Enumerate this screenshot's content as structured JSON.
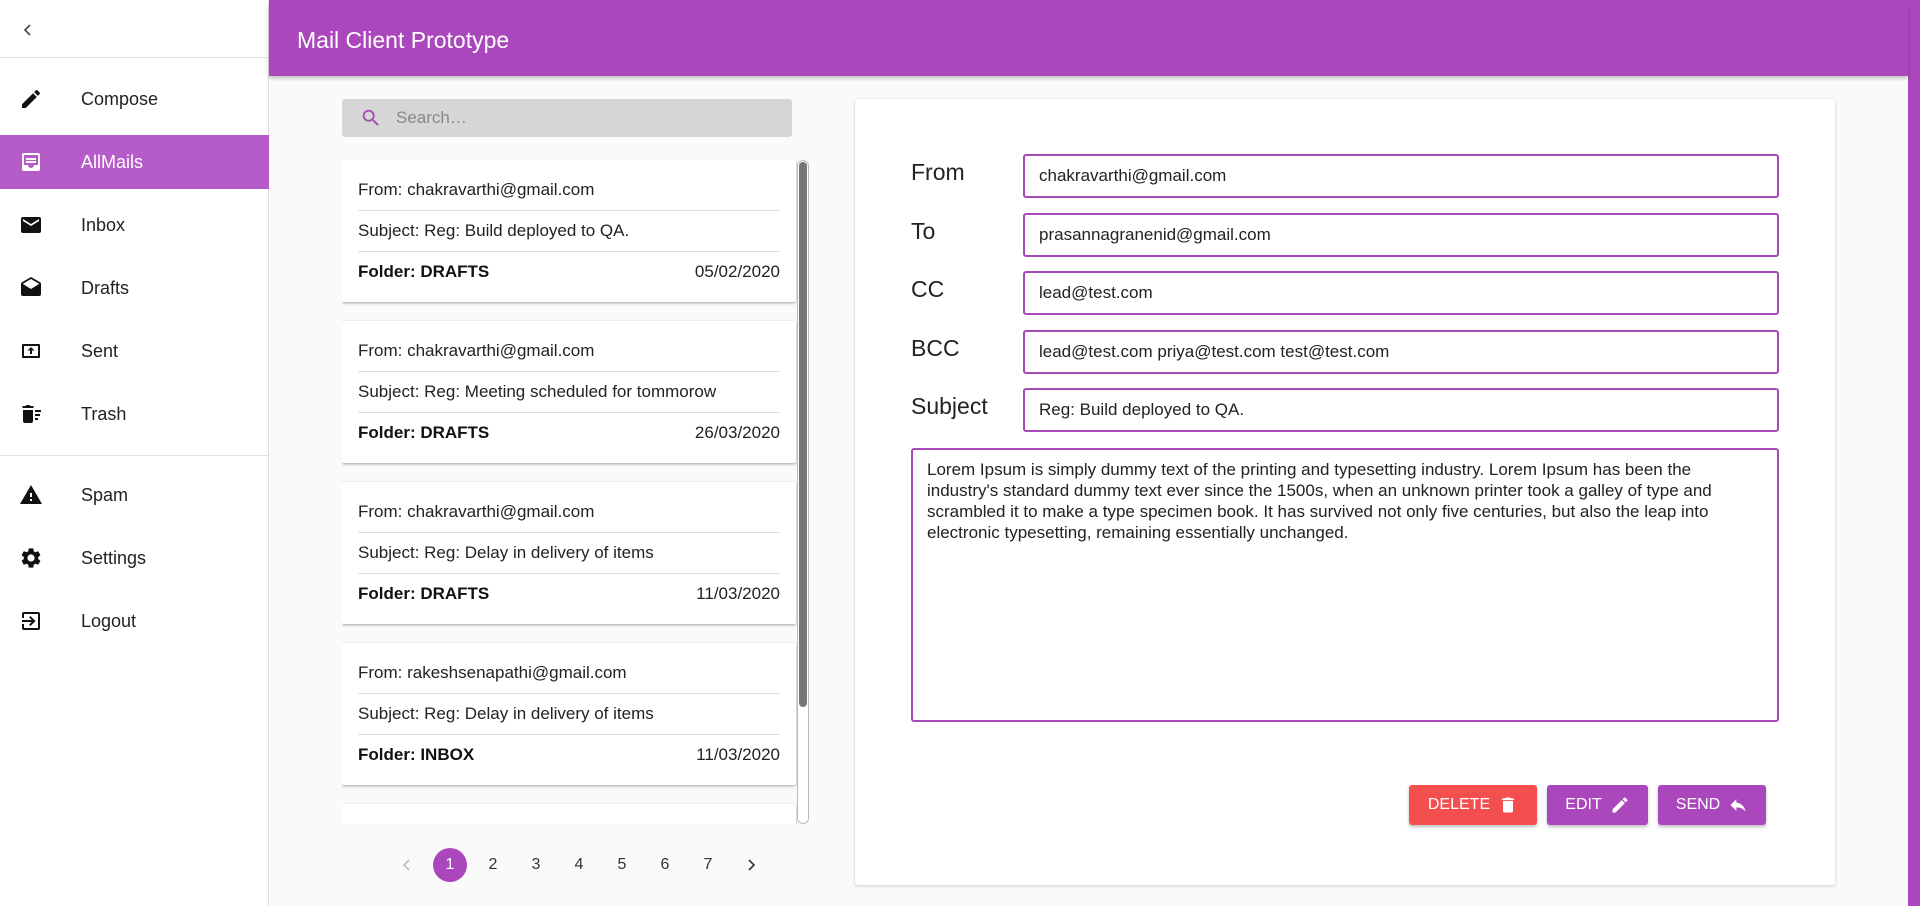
{
  "app": {
    "title": "Mail Client Prototype"
  },
  "colors": {
    "primary": "#ab47bc",
    "active_item": "#b55cc8",
    "danger": "#f44f4f"
  },
  "sidebar": {
    "collapse_icon": "chevron-left-icon",
    "items": [
      {
        "label": "Compose",
        "icon": "pencil-icon",
        "active": false
      },
      {
        "label": "AllMails",
        "icon": "inbox-tray-icon",
        "active": true
      },
      {
        "label": "Inbox",
        "icon": "envelope-icon",
        "active": false
      },
      {
        "label": "Drafts",
        "icon": "envelope-open-icon",
        "active": false
      },
      {
        "label": "Sent",
        "icon": "outbox-icon",
        "active": false
      },
      {
        "label": "Trash",
        "icon": "trash-icon",
        "active": false
      }
    ],
    "items2": [
      {
        "label": "Spam",
        "icon": "warning-icon"
      },
      {
        "label": "Settings",
        "icon": "gear-icon"
      },
      {
        "label": "Logout",
        "icon": "logout-icon"
      }
    ]
  },
  "search": {
    "placeholder": "Search…",
    "value": ""
  },
  "mails": [
    {
      "from": "From: chakravarthi@gmail.com",
      "subject": "Subject: Reg: Build deployed to QA.",
      "folder": "Folder: DRAFTS",
      "date": "05/02/2020"
    },
    {
      "from": "From: chakravarthi@gmail.com",
      "subject": "Subject: Reg: Meeting scheduled for tommorow",
      "folder": "Folder: DRAFTS",
      "date": "26/03/2020"
    },
    {
      "from": "From: chakravarthi@gmail.com",
      "subject": "Subject: Reg: Delay in delivery of items",
      "folder": "Folder: DRAFTS",
      "date": "11/03/2020"
    },
    {
      "from": "From: rakeshsenapathi@gmail.com",
      "subject": "Subject: Reg: Delay in delivery of items",
      "folder": "Folder: INBOX",
      "date": "11/03/2020"
    }
  ],
  "pagination": {
    "pages": [
      "1",
      "2",
      "3",
      "4",
      "5",
      "6",
      "7"
    ],
    "current": "1"
  },
  "detail": {
    "from_label": "From",
    "from_value": "chakravarthi@gmail.com",
    "to_label": "To",
    "to_value": "prasannagranenid@gmail.com",
    "cc_label": "CC",
    "cc_value": "lead@test.com",
    "bcc_label": "BCC",
    "bcc_value": "lead@test.com priya@test.com test@test.com",
    "subject_label": "Subject",
    "subject_value": "Reg: Build deployed to QA.",
    "body": "Lorem Ipsum is simply dummy text of the printing and typesetting industry. Lorem Ipsum has been the industry's standard dummy text ever since the 1500s, when an unknown printer took a galley of type and scrambled it to make a type specimen book. It has survived not only five centuries, but also the leap into electronic typesetting, remaining essentially unchanged."
  },
  "actions": {
    "delete_label": "DELETE",
    "edit_label": "EDIT",
    "send_label": "SEND"
  }
}
